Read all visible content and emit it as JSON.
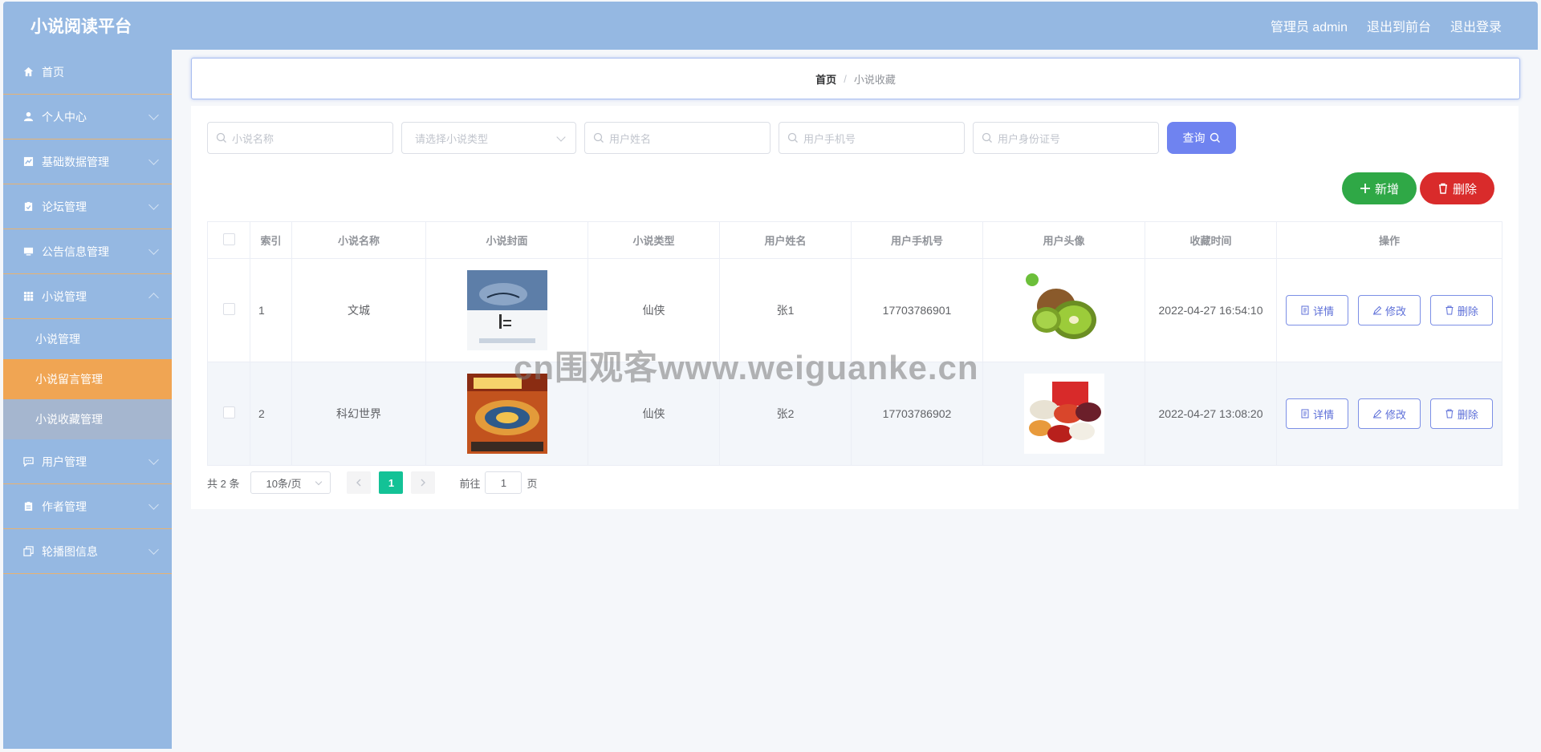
{
  "header": {
    "title": "小说阅读平台",
    "admin_label": "管理员 admin",
    "to_front_label": "退出到前台",
    "logout_label": "退出登录"
  },
  "sidebar": {
    "items": [
      {
        "label": "首页",
        "icon": "home-icon"
      },
      {
        "label": "个人中心",
        "icon": "user-icon"
      },
      {
        "label": "基础数据管理",
        "icon": "chart-icon"
      },
      {
        "label": "论坛管理",
        "icon": "clipboard-icon"
      },
      {
        "label": "公告信息管理",
        "icon": "monitor-icon"
      },
      {
        "label": "小说管理",
        "icon": "grid-icon"
      }
    ],
    "sub_items": [
      {
        "label": "小说管理"
      },
      {
        "label": "小说留言管理"
      },
      {
        "label": "小说收藏管理"
      }
    ],
    "items_after": [
      {
        "label": "用户管理",
        "icon": "chat-icon"
      },
      {
        "label": "作者管理",
        "icon": "clipboard-icon"
      },
      {
        "label": "轮播图信息",
        "icon": "copy-icon"
      }
    ]
  },
  "breadcrumb": {
    "home": "首页",
    "sep": "/",
    "current": "小说收藏"
  },
  "search": {
    "novel_name_placeholder": "小说名称",
    "novel_type_placeholder": "请选择小说类型",
    "user_name_placeholder": "用户姓名",
    "user_phone_placeholder": "用户手机号",
    "user_id_placeholder": "用户身份证号",
    "query_label": "查询"
  },
  "actions": {
    "add_label": "新增",
    "delete_label": "删除"
  },
  "table": {
    "headers": [
      "",
      "索引",
      "小说名称",
      "小说封面",
      "小说类型",
      "用户姓名",
      "用户手机号",
      "用户头像",
      "收藏时间",
      "操作"
    ],
    "rows": [
      {
        "index": "1",
        "name": "文城",
        "type": "仙侠",
        "user": "张1",
        "phone": "17703786901",
        "time": "2022-04-27 16:54:10"
      },
      {
        "index": "2",
        "name": "科幻世界",
        "type": "仙侠",
        "user": "张2",
        "phone": "17703786902",
        "time": "2022-04-27 13:08:20"
      }
    ],
    "op_detail": "详情",
    "op_edit": "修改",
    "op_delete": "删除"
  },
  "pager": {
    "total": "共 2 条",
    "page_size": "10条/页",
    "current_page": "1",
    "goto_prefix": "前往",
    "goto_value": "1",
    "goto_suffix": "页"
  },
  "watermark": "cn围观客www.weiguanke.cn",
  "colors": {
    "header": "#95b8e2",
    "active_menu": "#f0a553",
    "add": "#2fa846",
    "delete": "#d92b2b",
    "query": "#6f83f0"
  }
}
